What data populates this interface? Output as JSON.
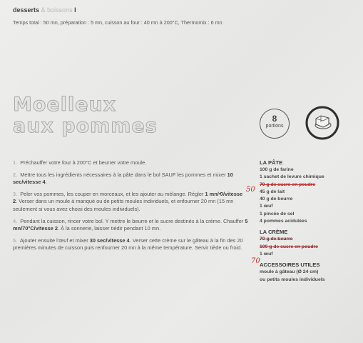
{
  "header": {
    "category": "desserts",
    "category_secondary": "& boissons",
    "page_marker": "I",
    "times": "Temps total : 50 mn, préparation : 5 mn, cuisson au four : 40 mn à 200°C, Thermomix : 6 mn"
  },
  "title": {
    "line1": "Moelleux",
    "line2": "aux pommes"
  },
  "portions": {
    "number": "8",
    "label": "portions"
  },
  "steps": [
    {
      "num": "1.",
      "text": "Préchauffer votre four à 200°C et beurrer votre moule."
    },
    {
      "num": "2.",
      "text": "Mettre tous les ingrédients nécessaires à la pâte dans le bol SAUF les pommes et mixer",
      "bold": " 10 sec/vitesse 4",
      "tail": "."
    },
    {
      "num": "3.",
      "text": "Peler vos pommes, les couper en morceaux, et les ajouter au mélange. Régler",
      "bold": " 1 mn/⟲/vitesse 2",
      "tail": ". Verser dans un moule à manqué ou de petits moules individuels, et enfourner 20 mn (15 mn seulement si vous avez choisi des moules individuels)."
    },
    {
      "num": "4.",
      "text": "Pendant la cuisson, rincer votre bol. Y mettre le beurre et le sucre destinés à la crème. Chauffer",
      "bold": " 5 mn/70°C/vitesse 2",
      "tail": ". À la sonnerie, laisser tiédir pendant 10 mn."
    },
    {
      "num": "5.",
      "text": "Ajouter ensuite l'œuf et mixer",
      "bold": " 30 sec/vitesse 4",
      "tail": ". Verser cette crème sur le gâteau à la fin des 20 premières minutes de cuisson puis renfourner 20 mn à la même température. Servir tiède ou froid."
    }
  ],
  "ingredients": {
    "pate": {
      "heading": "LA PÂTE",
      "items": [
        "100 g de farine",
        "1 sachet de levure chimique",
        "70 g de sucre en poudre",
        "45 g de lait",
        "40 g de beurre",
        "1 œuf",
        "1 pincée de sel",
        "4 pommes acidulées"
      ]
    },
    "creme": {
      "heading": "LA CRÈME",
      "items": [
        "70 g de beurre",
        "100 g de sucre en poudre",
        "1 œuf"
      ]
    }
  },
  "accessories": {
    "heading": "ACCESSOIRES UTILES",
    "items": [
      "moule à gâteau (Ø 24 cm)",
      "ou petits moules individuels"
    ]
  },
  "handwritten": {
    "sugar_pate": "50",
    "sugar_creme": "70"
  },
  "colors": {
    "paper": "#e9e9e7",
    "text": "#3a3a3a",
    "handwriting": "#c92a2a",
    "title_outline": "#a9a9a9"
  }
}
